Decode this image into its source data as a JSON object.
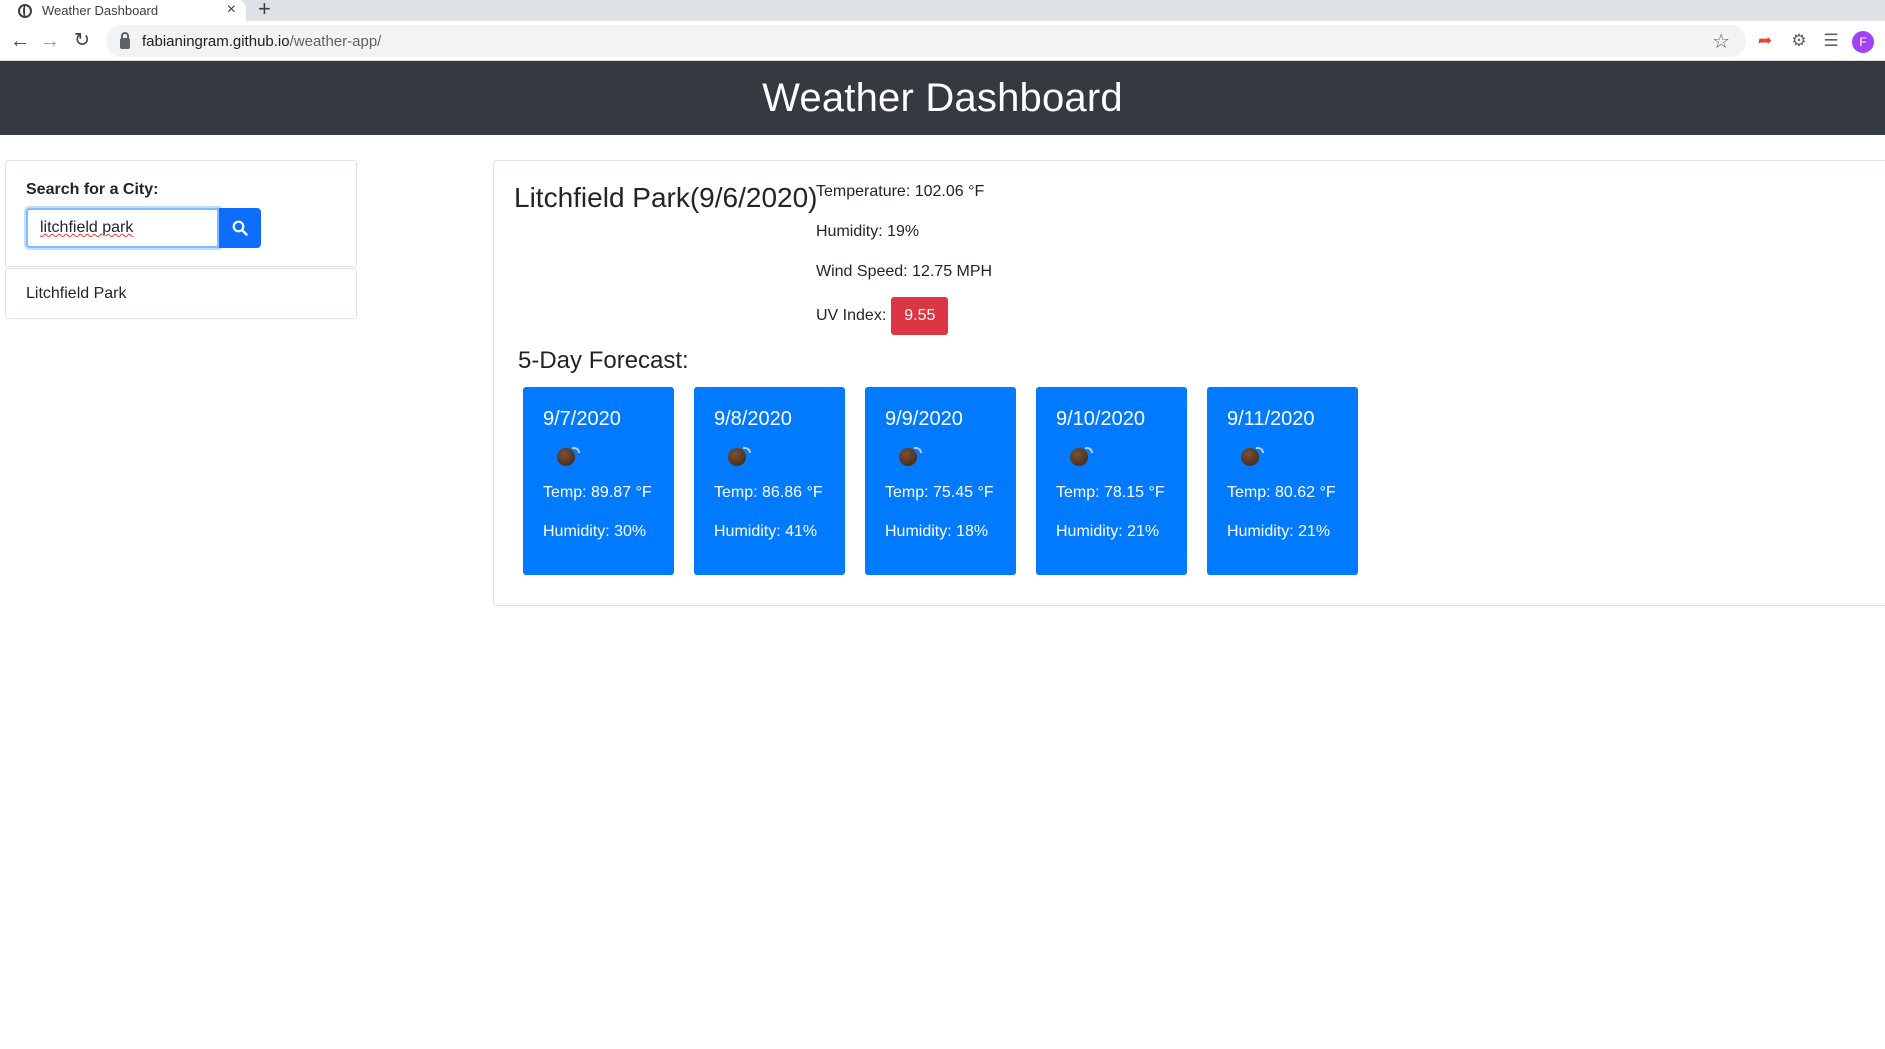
{
  "browser": {
    "tab_title": "Weather Dashboard",
    "tab_close": "×",
    "new_tab": "+",
    "url_host": "fabianingram.github.io",
    "url_path": "/weather-app/",
    "avatar_letter": "F"
  },
  "header": {
    "title": "Weather Dashboard"
  },
  "sidebar": {
    "search_label": "Search for a City:",
    "search_value": "litchfield park",
    "search_icon": "search-icon",
    "history": [
      "Litchfield Park"
    ]
  },
  "current": {
    "city_title": "Litchfield Park(9/6/2020)",
    "temperature": "Temperature: 102.06 °F",
    "humidity": "Humidity: 19%",
    "wind": "Wind Speed: 12.75 MPH",
    "uv_label": "UV Index:",
    "uv_value": "9.55",
    "uv_color": "#dc3545"
  },
  "forecast": {
    "title": "5-Day Forecast:",
    "card_color": "#007bff",
    "icon": "bomb-icon",
    "days": [
      {
        "date": "9/7/2020",
        "temp": "Temp: 89.87 °F",
        "humidity": "Humidity: 30%"
      },
      {
        "date": "9/8/2020",
        "temp": "Temp: 86.86 °F",
        "humidity": "Humidity: 41%"
      },
      {
        "date": "9/9/2020",
        "temp": "Temp: 75.45 °F",
        "humidity": "Humidity: 18%"
      },
      {
        "date": "9/10/2020",
        "temp": "Temp: 78.15 °F",
        "humidity": "Humidity: 21%"
      },
      {
        "date": "9/11/2020",
        "temp": "Temp: 80.62 °F",
        "humidity": "Humidity: 21%"
      }
    ]
  }
}
